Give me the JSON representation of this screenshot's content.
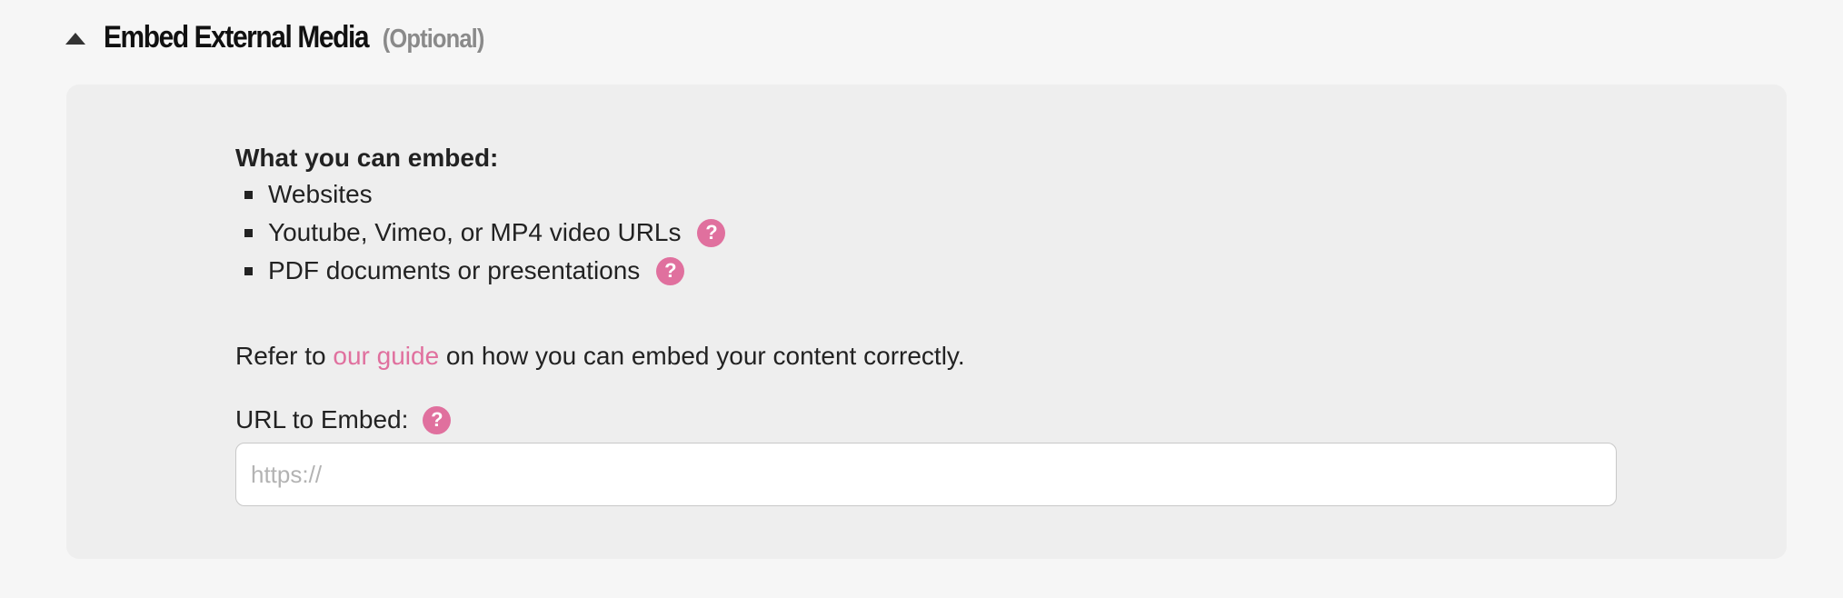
{
  "section": {
    "title": "Embed External Media",
    "optional_label": "(Optional)",
    "toggle_icon": "triangle-up-icon"
  },
  "panel": {
    "can_embed_title": "What you can embed:",
    "items": [
      {
        "label": "Websites",
        "has_help": false
      },
      {
        "label": "Youtube, Vimeo, or MP4 video URLs",
        "has_help": true
      },
      {
        "label": "PDF documents or presentations",
        "has_help": true
      }
    ],
    "guide": {
      "prefix": "Refer to ",
      "link_text": "our guide",
      "suffix": " on how you can embed your content correctly."
    },
    "url_field": {
      "label": "URL to Embed:",
      "placeholder": "https://",
      "value": ""
    },
    "help_icon_glyph": "?"
  },
  "colors": {
    "accent": "#e0709e",
    "panel_bg": "#eeeeee",
    "page_bg": "#f6f6f6",
    "muted_text": "#8a8a8a"
  }
}
